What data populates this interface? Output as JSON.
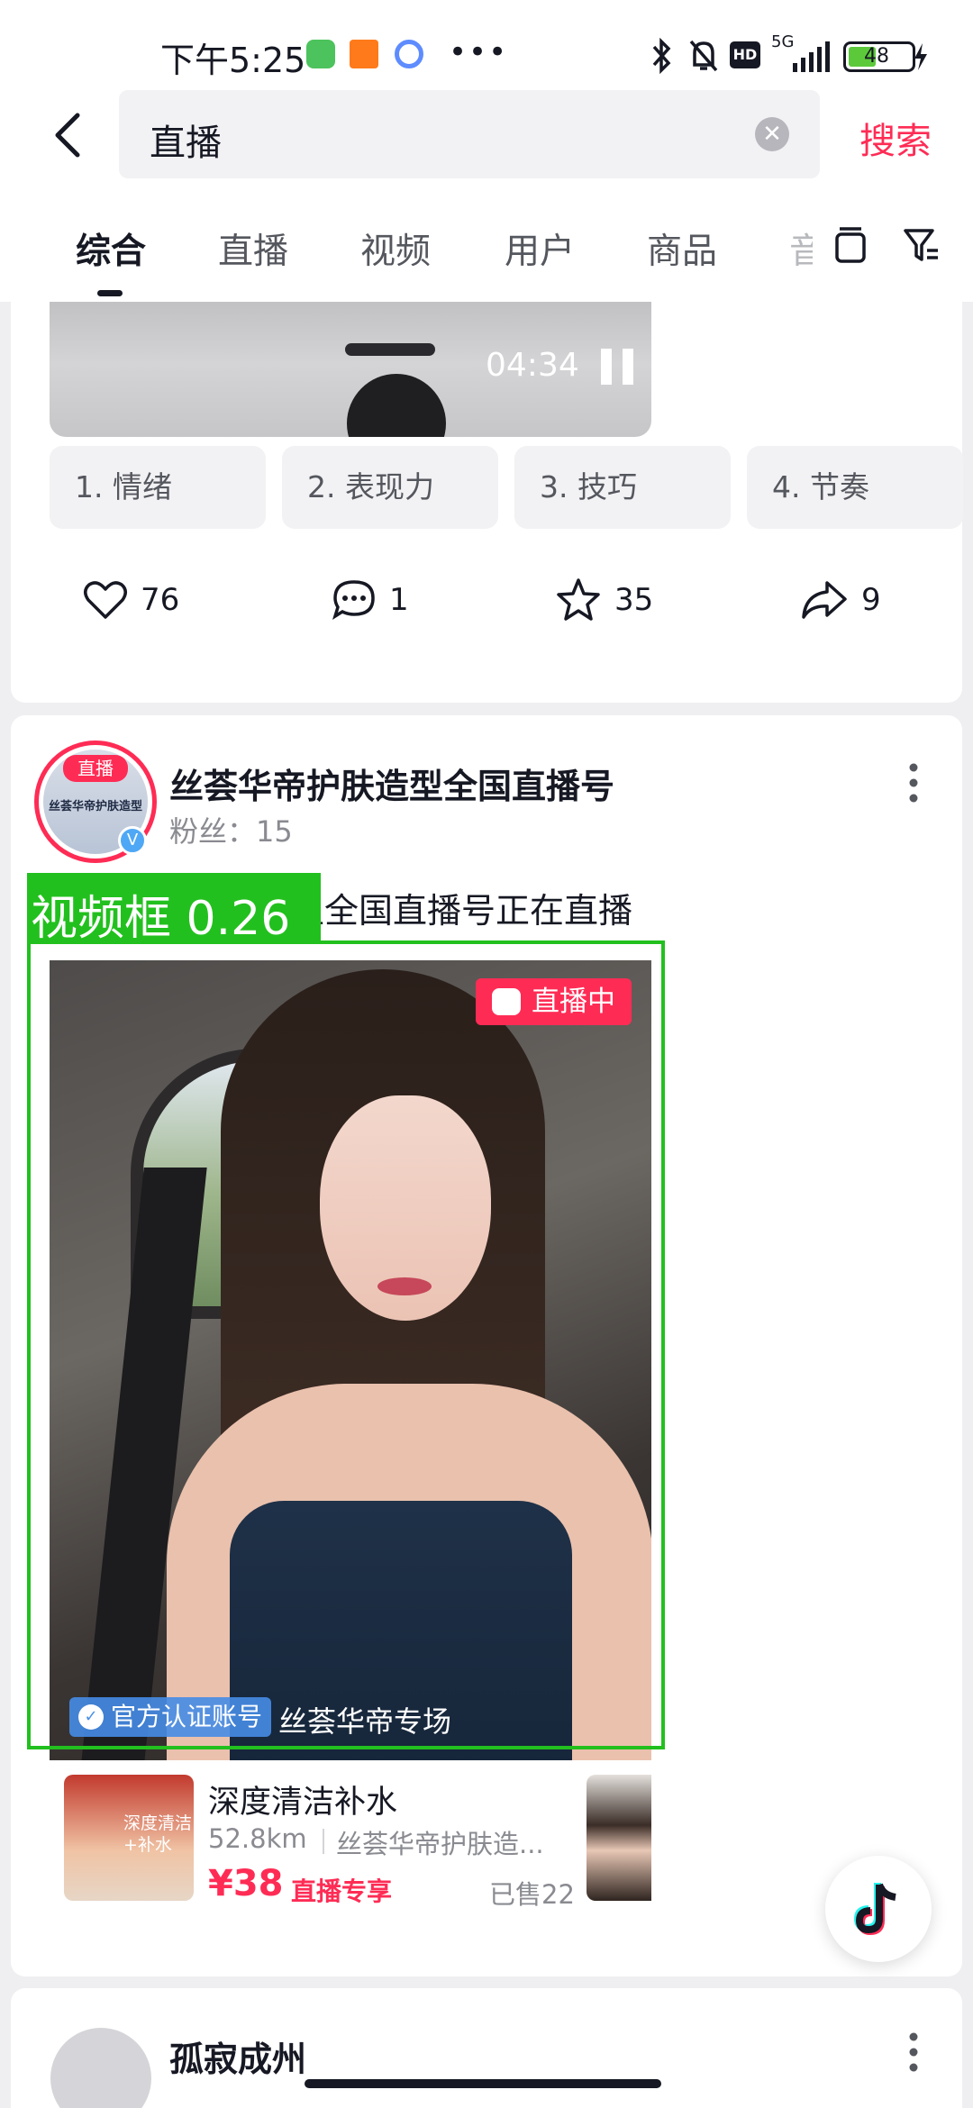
{
  "status_bar": {
    "time": "下午5:25",
    "network": "5G",
    "battery": "48"
  },
  "search": {
    "query": "直播",
    "search_label": "搜索"
  },
  "tabs": [
    {
      "label": "综合",
      "active": true
    },
    {
      "label": "直播",
      "active": false
    },
    {
      "label": "视频",
      "active": false
    },
    {
      "label": "用户",
      "active": false
    },
    {
      "label": "商品",
      "active": false
    },
    {
      "label": "音",
      "active": false
    }
  ],
  "card1": {
    "duration": "04:34",
    "chapters": [
      "1. 情绪",
      "2. 表现力",
      "3. 技巧",
      "4. 节奏"
    ],
    "likes": "76",
    "comments": "1",
    "favorites": "35",
    "shares": "9"
  },
  "card2": {
    "avatar_badge": "直播",
    "avatar_text": "丝荟华帝护肤造型",
    "author": "丝荟华帝护肤造型全国直播号",
    "followers": "粉丝：15",
    "description": "丝荟华帝护肤造型全国直播号正在直播",
    "detection_label": "视频框 0.26",
    "live_label": "直播中",
    "official_label": "官方认证账号",
    "room_name": "丝荟华帝专场",
    "product": {
      "title": "深度清洁补水",
      "distance": "52.8km",
      "shop": "丝荟华帝护肤造...",
      "price": "¥38",
      "price_tag": "直播专享",
      "sold": "已售22",
      "thumb_text": "深度清洁+补水"
    }
  },
  "card3": {
    "author": "孤寂成州"
  },
  "colors": {
    "accent": "#fe2c55",
    "detection_box": "#22c01e",
    "text": "#161823"
  }
}
